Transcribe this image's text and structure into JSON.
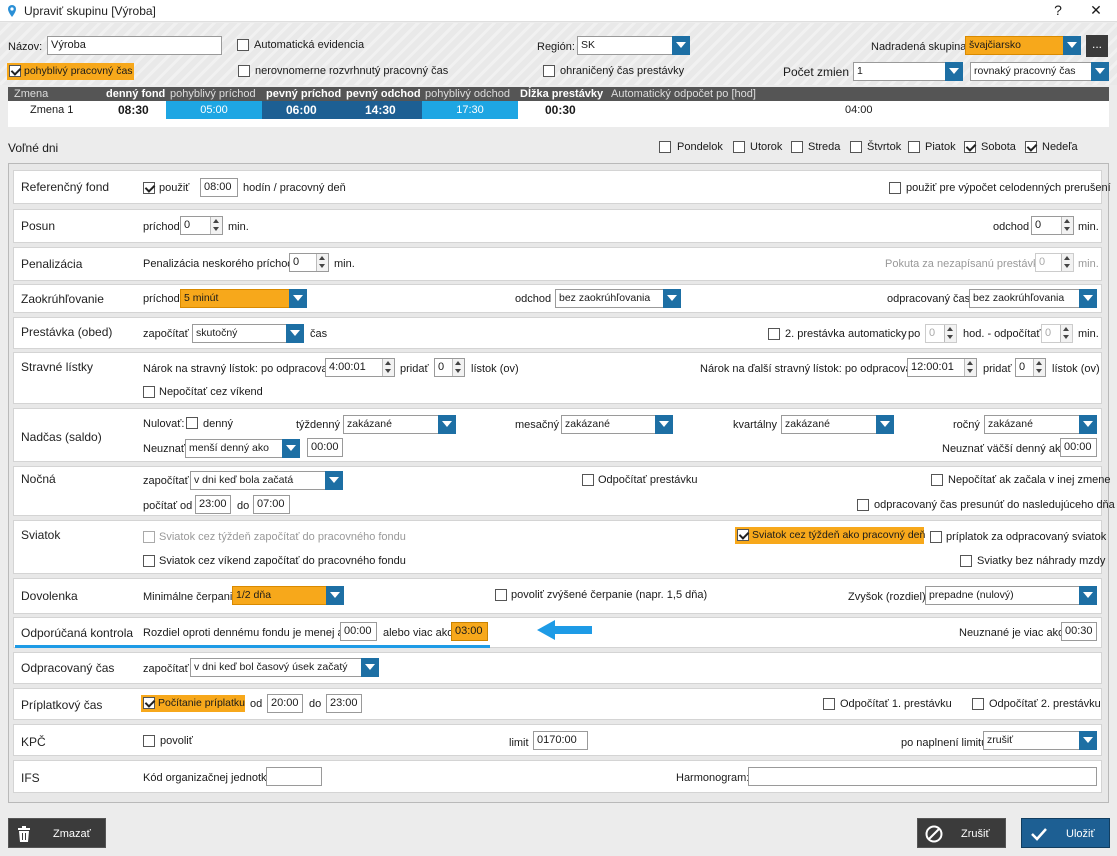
{
  "window": {
    "title": "Upraviť skupinu [Výroba]",
    "help": "?",
    "close": "✕"
  },
  "top": {
    "nazov_label": "Názov:",
    "nazov_value": "Výroba",
    "auto_evid": "Automatická evidencia",
    "region_label": "Región:",
    "region_value": "SK",
    "nadr_label": "Nadradená skupina:",
    "nadr_value": "švajčiarsko",
    "more": "...",
    "pohyblivy": "pohyblivý pracovný čas",
    "nerov": "nerovnomerne rozvrhnutý pracovný čas",
    "ohran": "ohraničený čas prestávky",
    "pocet_label": "Počet zmien",
    "pocet_value": "1",
    "rovnaky": "rovnaký pracovný čas"
  },
  "shift_table": {
    "headers": [
      "Zmena",
      "denný fond",
      "pohyblivý príchod",
      "pevný príchod",
      "pevný odchod",
      "pohyblivý odchod",
      "Dĺžka prestávky",
      "Automatický odpočet po [hod]"
    ],
    "row": [
      "Zmena 1",
      "08:30",
      "05:00",
      "06:00",
      "14:30",
      "17:30",
      "00:30",
      "04:00"
    ]
  },
  "volne": {
    "label": "Voľné dni",
    "days": [
      {
        "n": "Pondelok",
        "c": false
      },
      {
        "n": "Utorok",
        "c": false
      },
      {
        "n": "Streda",
        "c": false
      },
      {
        "n": "Štvrtok",
        "c": false
      },
      {
        "n": "Piatok",
        "c": false
      },
      {
        "n": "Sobota",
        "c": true
      },
      {
        "n": "Nedeľa",
        "c": true
      }
    ]
  },
  "ref": {
    "label": "Referenčný fond",
    "pouzit": "použiť",
    "hod": "08:00",
    "hod_label": "hodín / pracovný deň",
    "celoden": "použiť pre výpočet celodenných prerušení"
  },
  "posun": {
    "label": "Posun",
    "prichod": "príchod",
    "prichod_v": "0",
    "min": "min.",
    "odchod": "odchod",
    "odchod_v": "0"
  },
  "penal": {
    "label": "Penalizácia",
    "neskory": "Penalizácia neskorého príchodu:",
    "neskory_v": "0",
    "min": "min.",
    "pokuta": "Pokuta za nezapísanú prestávku",
    "pokuta_v": "0"
  },
  "zaok": {
    "label": "Zaokrúhľovanie",
    "prichod": "príchod",
    "prichod_v": "5 minút",
    "odchod": "odchod",
    "odchod_v": "bez zaokrúhľovania",
    "odprac": "odpracovaný čas",
    "odprac_v": "bez zaokrúhľovania"
  },
  "prest": {
    "label": "Prestávka (obed)",
    "zapoc": "započítať",
    "zapoc_v": "skutočný",
    "cas": "čas",
    "druha": "2. prestávka automaticky",
    "po": "po",
    "po_v": "0",
    "hod": "hod. - odpočítať",
    "odp_v": "0",
    "min": "min."
  },
  "strav": {
    "label": "Stravné lístky",
    "narok": "Nárok na stravný lístok: po odpracovaní",
    "narok_v": "4:00:01",
    "pridat": "pridať",
    "pridat_v": "0",
    "listok": "lístok (ov)",
    "dalsi": "Nárok na ďalší stravný lístok: po odpracovaní",
    "dalsi_v": "12:00:01",
    "pridat2_v": "0",
    "vikend": "Nepočítať cez víkend"
  },
  "nadcas": {
    "label": "Nadčas (saldo)",
    "nulovat": "Nulovať:",
    "denny": "denný",
    "tyzd": "týždenný",
    "tyzd_v": "zakázané",
    "mes": "mesačný",
    "mes_v": "zakázané",
    "kvart": "kvartálny",
    "kvart_v": "zakázané",
    "rocny": "ročný",
    "rocny_v": "zakázané",
    "neuznat": "Neuznať",
    "neuznat_v": "menší denný ako",
    "neuznat_t": "00:00",
    "neuznat2": "Neuznať väčší denný ako",
    "neuznat2_t": "00:00"
  },
  "nocna": {
    "label": "Nočná",
    "zapoc": "započítať",
    "zapoc_v": "v dni keď bola začatá",
    "odpoc": "Odpočítať prestávku",
    "nepoc": "Nepočítať ak začala v inej zmene",
    "pocitat": "počítať",
    "od": "od",
    "od_v": "23:00",
    "do": "do",
    "do_v": "07:00",
    "presun": "odpracovaný čas presunúť do nasledujúceho dňa"
  },
  "sviatok": {
    "label": "Sviatok",
    "tyzden": "Sviatok cez týždeň započítať do pracovného fondu",
    "ako_prac": "Sviatok cez týždeň ako pracovný deň",
    "priplatok": "príplatok za odpracovaný sviatok",
    "vikend": "Sviatok cez víkend započítať do pracovného fondu",
    "bez": "Sviatky bez náhrady mzdy"
  },
  "dovol": {
    "label": "Dovolenka",
    "min": "Minimálne čerpanie",
    "min_v": "1/2 dňa",
    "zvys": "povoliť zvýšené čerpanie (napr. 1,5 dňa)",
    "zvysok": "Zvyšok (rozdiel)",
    "zvysok_v": "prepadne (nulový)"
  },
  "odpor": {
    "label": "Odporúčaná kontrola",
    "rozdiel": "Rozdiel oproti dennému fondu je menej ako",
    "r1": "00:00",
    "alebo": "alebo viac ako",
    "r2": "03:00",
    "neuzn": "Neuznané je viac ako",
    "r3": "00:30"
  },
  "odprac": {
    "label": "Odpracovaný čas",
    "zapoc": "započítať",
    "zapoc_v": "v dni keď bol časový úsek začatý"
  },
  "pripl": {
    "label": "Príplatkový čas",
    "pocit": "Počítanie príplatku",
    "od": "od",
    "od_v": "20:00",
    "do": "do",
    "do_v": "23:00",
    "p1": "Odpočítať 1. prestávku",
    "p2": "Odpočítať 2. prestávku"
  },
  "kpc": {
    "label": "KPČ",
    "povolit": "povoliť",
    "limit": "limit",
    "limit_v": "0170:00",
    "po": "po naplnení limitu",
    "po_v": "zrušiť"
  },
  "ifs": {
    "label": "IFS",
    "kod": "Kód organizačnej jednotky",
    "kod_v": "",
    "harm": "Harmonogram:",
    "harm_v": ""
  },
  "buttons": {
    "delete": "Zmazať",
    "cancel": "Zrušiť",
    "save": "Uložiť"
  },
  "colors": {
    "accent": "#1d6fa4",
    "orange": "#f7a81b",
    "arrow": "#1e9be6"
  }
}
